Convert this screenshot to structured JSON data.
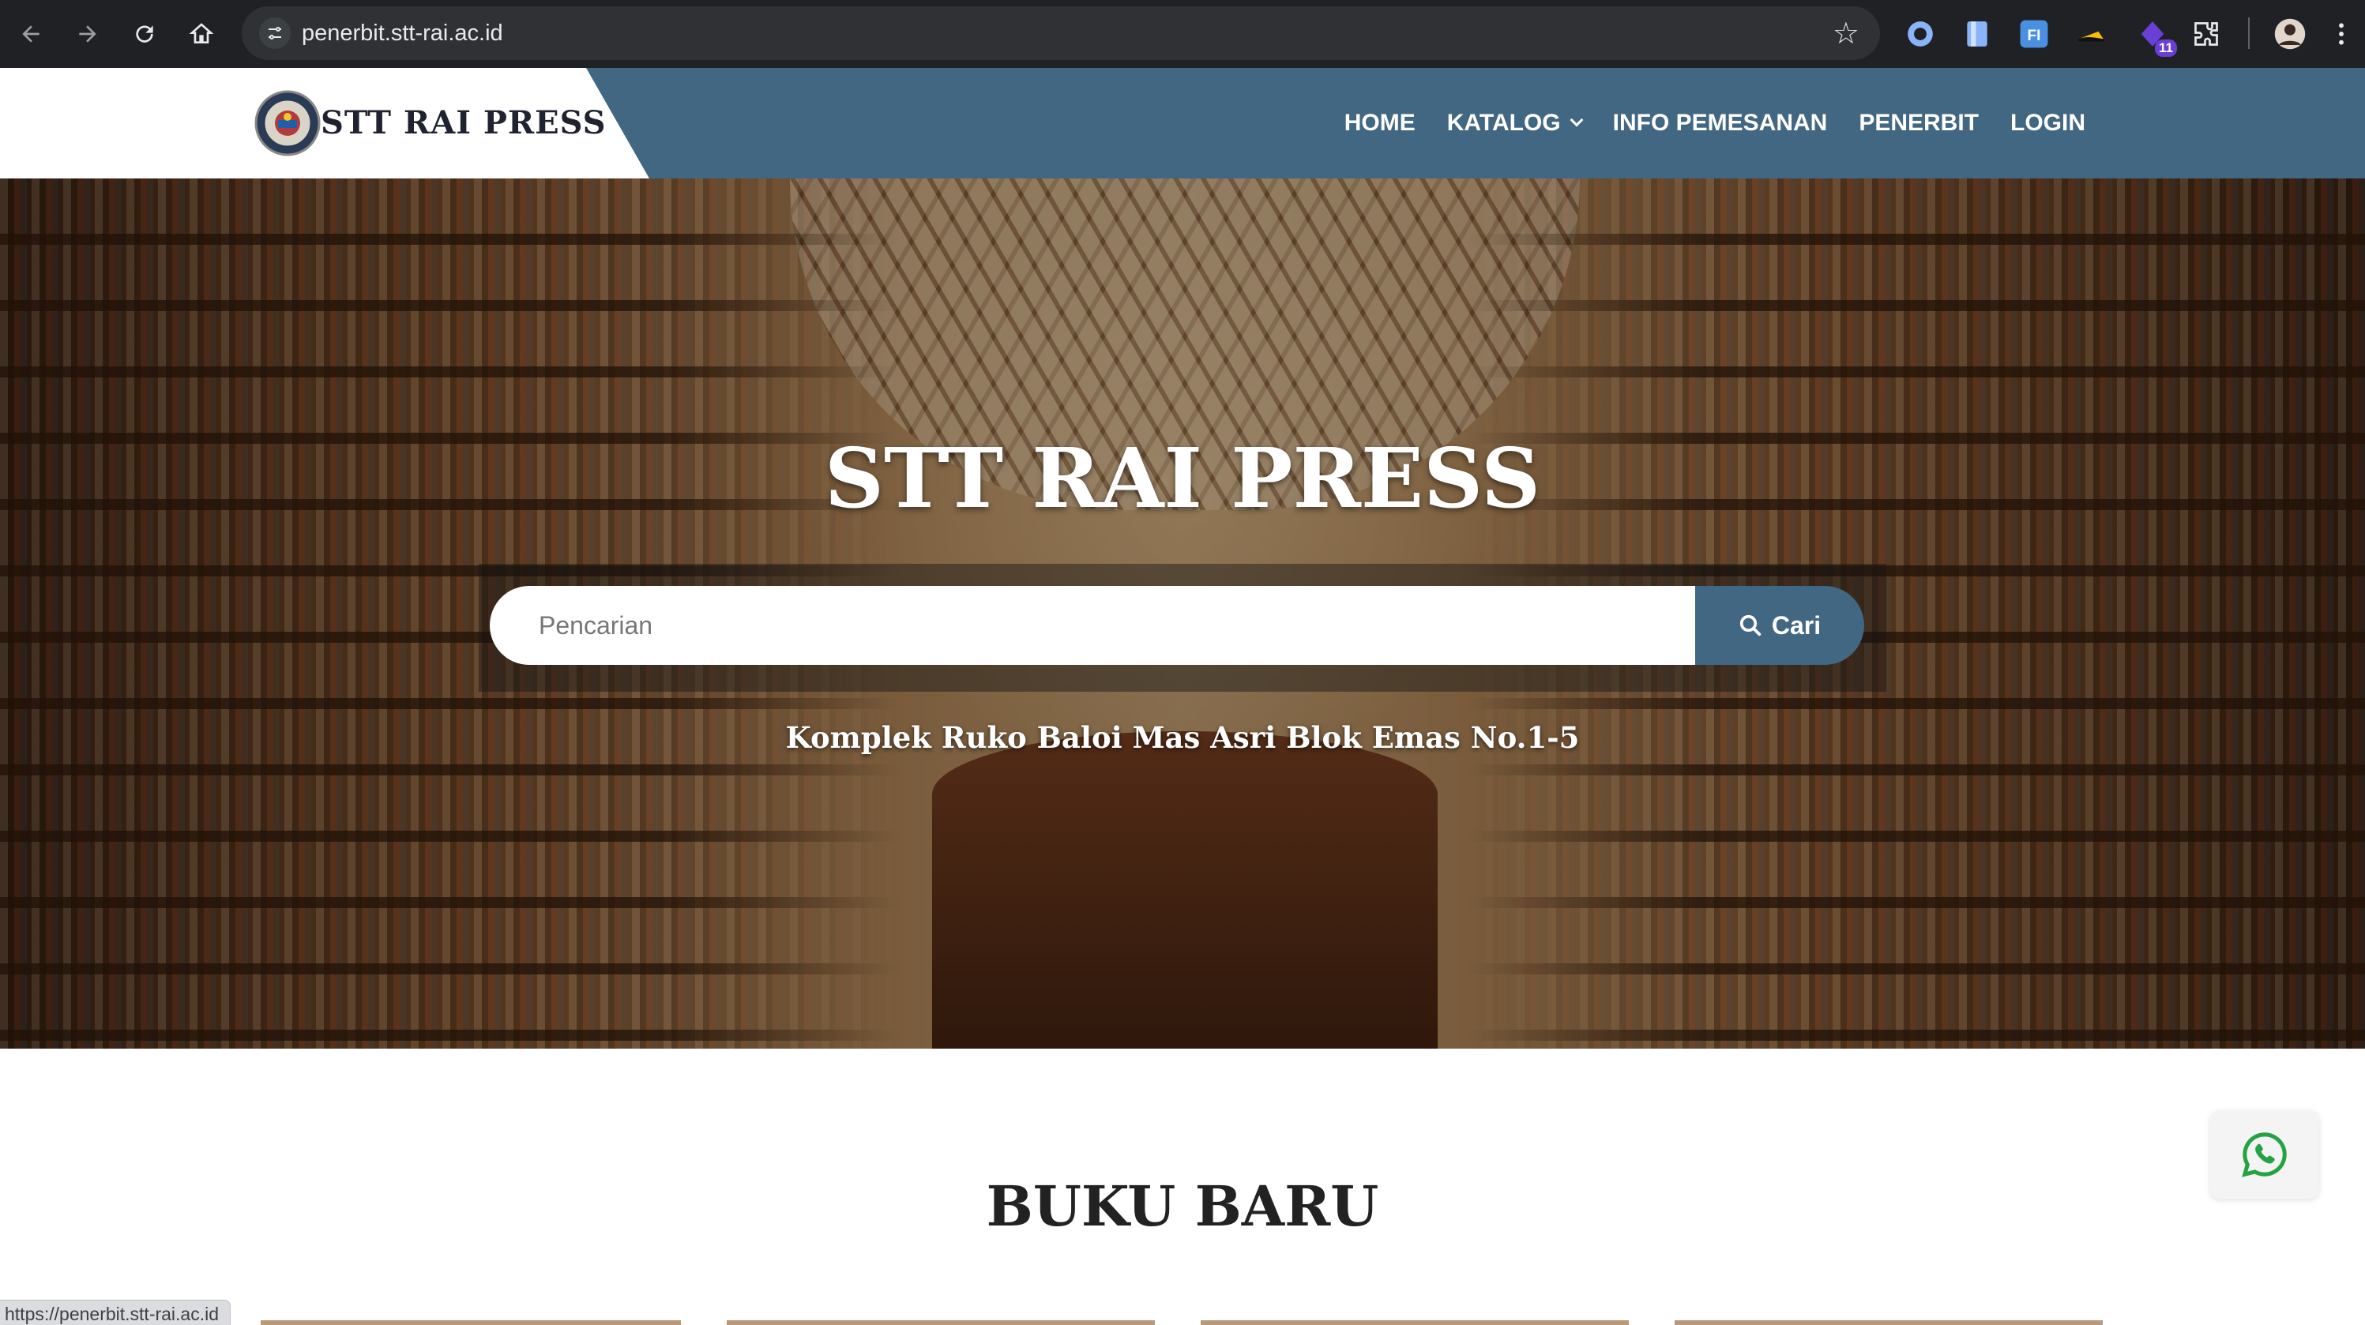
{
  "browser": {
    "url": "penerbit.stt-rai.ac.id",
    "status_url": "https://penerbit.stt-rai.ac.id",
    "extensions": [
      "circle-extension-icon",
      "document-extension-icon",
      "fi-extension-icon",
      "bird-extension-icon",
      "purple-extension-icon",
      "puzzle-extensions-icon"
    ],
    "extension_badge": "11",
    "fi_label": "FI"
  },
  "header": {
    "logo_text": "STT RAI PRESS",
    "menu": [
      {
        "label": "HOME"
      },
      {
        "label": "KATALOG"
      },
      {
        "label": "INFO PEMESANAN"
      },
      {
        "label": "PENERBIT"
      },
      {
        "label": "LOGIN"
      }
    ],
    "bg_color": "#416783"
  },
  "hero": {
    "title": "STT RAI PRESS",
    "search_placeholder": "Pencarian",
    "search_button": "Cari",
    "address": "Komplek Ruko Baloi Mas Asri Blok Emas No.1-5"
  },
  "section": {
    "title": "BUKU BARU"
  },
  "colors": {
    "accent": "#416783",
    "whatsapp": "#25a244"
  }
}
